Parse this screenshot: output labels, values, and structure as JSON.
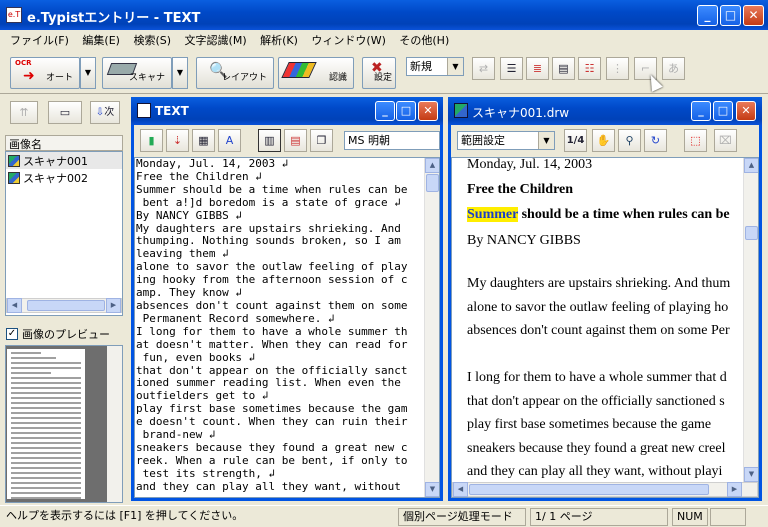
{
  "app": {
    "title": "e.Typistエントリー - TEXT",
    "icon_text": "e.T"
  },
  "menu": [
    "ファイル(F)",
    "編集(E)",
    "検索(S)",
    "文字認識(M)",
    "解析(K)",
    "ウィンドウ(W)",
    "その他(H)"
  ],
  "toolbar": {
    "auto_label": "オート",
    "auto_badge": "OCR",
    "scanner_label": "スキャナ",
    "layout_label": "レイアウト",
    "recognize_label": "認識",
    "settings_label": "設定",
    "new_select": "新規"
  },
  "left": {
    "next_label": "次",
    "list_header": "画像名",
    "files": [
      "スキャナ001",
      "スキャナ002"
    ],
    "preview_label": "画像のプレビュー",
    "preview_checked": true
  },
  "textwin": {
    "title": "TEXT",
    "font_select": "MS 明朝",
    "lines": [
      "Monday, Jul. 14, 2003 ↲",
      "Free the Children ↲",
      "Summer should be a time when rules can be",
      " bent a!]d boredom is a state of grace ↲",
      "By NANCY GIBBS ↲",
      "My daughters are upstairs shrieking. And",
      "thumping. Nothing sounds broken, so I am",
      "leaving them ↲",
      "alone to savor the outlaw feeling of play",
      "ing hooky from the afternoon session of c",
      "amp. They know ↲",
      "absences don't count against them on some",
      " Permanent Record somewhere. ↲",
      "I long for them to have a whole summer th",
      "at doesn't matter. When they can read for",
      " fun, even books ↲",
      "that don't appear on the officially sanct",
      "ioned summer reading list. When even the",
      "outfielders get to ↲",
      "play first base sometimes because the gam",
      "e doesn't count. When they can ruin their",
      " brand-new ↲",
      "sneakers because they found a great new c",
      "reek. When a rule can be bent, if only to",
      " test its strength, ↲",
      "and they can play all they want, without"
    ]
  },
  "imgwin": {
    "title": "スキャナ001.drw",
    "range_select": "範囲設定",
    "scale_label": "1/4",
    "doc": {
      "date": "Monday, Jul. 14, 2003",
      "heading": "Free the Children",
      "highlight": "Summer",
      "line1_rest": " should be a time when rules can be",
      "byline": "By NANCY GIBBS",
      "lines": [
        "My daughters are upstairs shrieking. And thum",
        "alone to savor the outlaw feeling of playing ho",
        "absences don't count against them on some Per",
        "",
        "I long for them to have a whole summer that d",
        "that don't appear on the officially sanctioned s",
        "play first base sometimes because the game",
        "sneakers because they found a great new creel",
        "and they can play all they want, without playi"
      ]
    }
  },
  "status": {
    "help": "ヘルプを表示するには [F1] を押してください。",
    "mode": "個別ページ処理モード",
    "page": "1/ 1 ページ",
    "num": "NUM"
  },
  "colors": {
    "title_blue": "#0049c8",
    "close_red": "#c43b14",
    "highlight": "#ffee00"
  }
}
